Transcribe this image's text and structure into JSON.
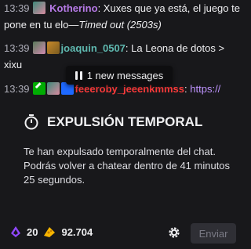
{
  "chat": {
    "messages": [
      {
        "time": "13:39",
        "user": "Kotherino",
        "text": " Xuxes que ya está, el juego te pone en tu elo—",
        "suffix": "Timed out (2503s)"
      },
      {
        "time": "13:39",
        "user": "joaquin_0507",
        "text": " La Leona de dotos > xixu"
      },
      {
        "time": "13:39",
        "user": "feeeroby_jeeenkmmss",
        "text": " https://"
      }
    ],
    "new_messages_label": "1 new messages"
  },
  "timeout": {
    "title": "EXPULSIÓN TEMPORAL",
    "body": "Te han expulsado temporalmente del chat. Podrás volver a chatear dentro de 41 minutos 25 segundos."
  },
  "footer": {
    "bits": "20",
    "points": "92.704",
    "send_label": "Enviar"
  },
  "colors": {
    "background": "#18181b",
    "accent": "#9147ff",
    "user_kotherino": "#b77ae7",
    "user_joaquin": "#5fb9b0",
    "user_feeeroby": "#ff3b3b"
  }
}
